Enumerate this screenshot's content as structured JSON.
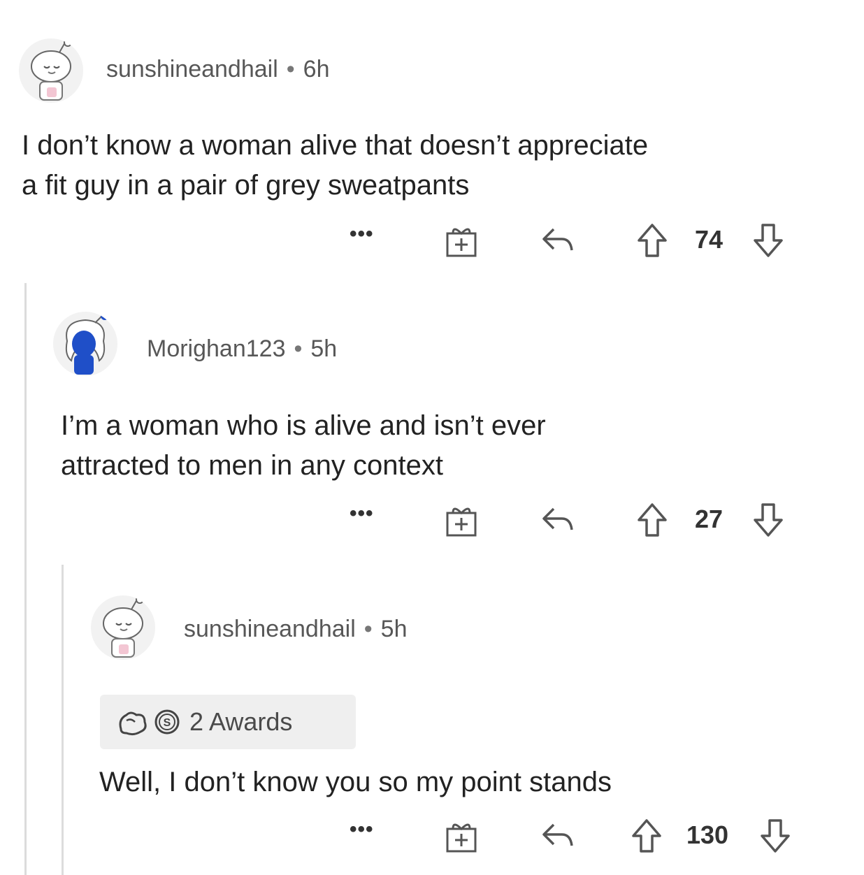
{
  "comments": [
    {
      "username": "sunshineandhail",
      "separator": "•",
      "age": "6h",
      "body": [
        "I don’t know a woman alive that doesn’t appreciate",
        "a fit guy in a pair of grey sweatpants"
      ],
      "actions": {
        "more": "•••",
        "score": "74"
      },
      "avatar_icon": "snoo-avatar-icon"
    },
    {
      "username": "Morighan123",
      "separator": "•",
      "age": "5h",
      "body": [
        "I’m a woman who is alive and isn’t ever",
        "attracted to men in any context"
      ],
      "actions": {
        "more": "•••",
        "score": "27"
      },
      "avatar_icon": "snoo-avatar-icon"
    },
    {
      "username": "sunshineandhail",
      "separator": "•",
      "age": "5h",
      "awards": "2 Awards",
      "body": [
        "Well, I don’t know you so my point stands"
      ],
      "actions": {
        "more": "•••",
        "score": "130"
      },
      "avatar_icon": "snoo-avatar-icon"
    }
  ],
  "colors": {
    "thread_line": "#dcdcdc",
    "meta_text": "#575757",
    "body_text": "#222222",
    "avatar_blue": "#1f4fc8"
  }
}
